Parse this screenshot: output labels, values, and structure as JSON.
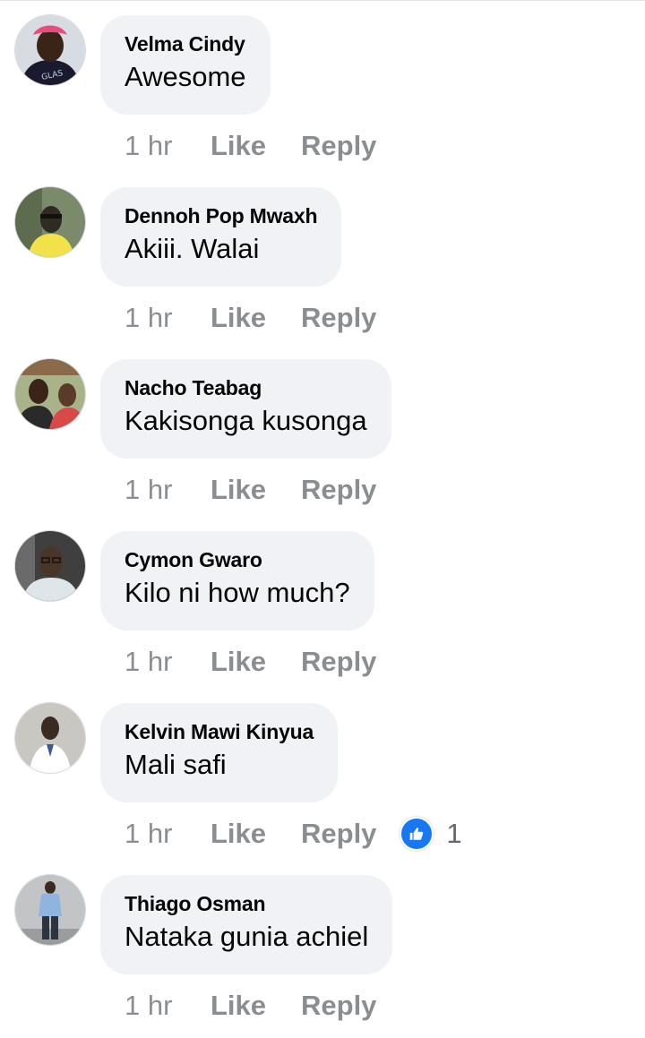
{
  "comments": [
    {
      "author": "Velma Cindy",
      "text": "Awesome",
      "time": "1 hr",
      "like_label": "Like",
      "reply_label": "Reply",
      "reaction_count": null,
      "avatar_colors": [
        "#4a6aa8",
        "#1a1a2e",
        "#e84d7a"
      ]
    },
    {
      "author": "Dennoh Pop Mwaxh",
      "text": "Akiii. Walai",
      "time": "1 hr",
      "like_label": "Like",
      "reply_label": "Reply",
      "reaction_count": null,
      "avatar_colors": [
        "#7a8a6a",
        "#2e2a24",
        "#f2e24a"
      ]
    },
    {
      "author": "Nacho Teabag",
      "text": "Kakisonga kusonga",
      "time": "1 hr",
      "like_label": "Like",
      "reply_label": "Reply",
      "reaction_count": null,
      "avatar_colors": [
        "#a9b38a",
        "#2a2a2a",
        "#d84a4a"
      ]
    },
    {
      "author": "Cymon Gwaro",
      "text": "Kilo ni how much?",
      "time": "1 hr",
      "like_label": "Like",
      "reply_label": "Reply",
      "reaction_count": null,
      "avatar_colors": [
        "#3f3f3f",
        "#4a3528",
        "#dfe6e9"
      ]
    },
    {
      "author": "Kelvin Mawi Kinyua",
      "text": "Mali safi",
      "time": "1 hr",
      "like_label": "Like",
      "reply_label": "Reply",
      "reaction_count": "1",
      "avatar_colors": [
        "#c9c7c2",
        "#3b2a22",
        "#ffffff"
      ]
    },
    {
      "author": "Thiago Osman",
      "text": "Nataka gunia achiel",
      "time": "1 hr",
      "like_label": "Like",
      "reply_label": "Reply",
      "reaction_count": null,
      "avatar_colors": [
        "#c2c4c6",
        "#3a2a20",
        "#8fb4e0"
      ]
    }
  ],
  "colors": {
    "bubble": "#f0f2f5",
    "meta_text": "#8a8d91",
    "like_badge": "#1877f2"
  }
}
